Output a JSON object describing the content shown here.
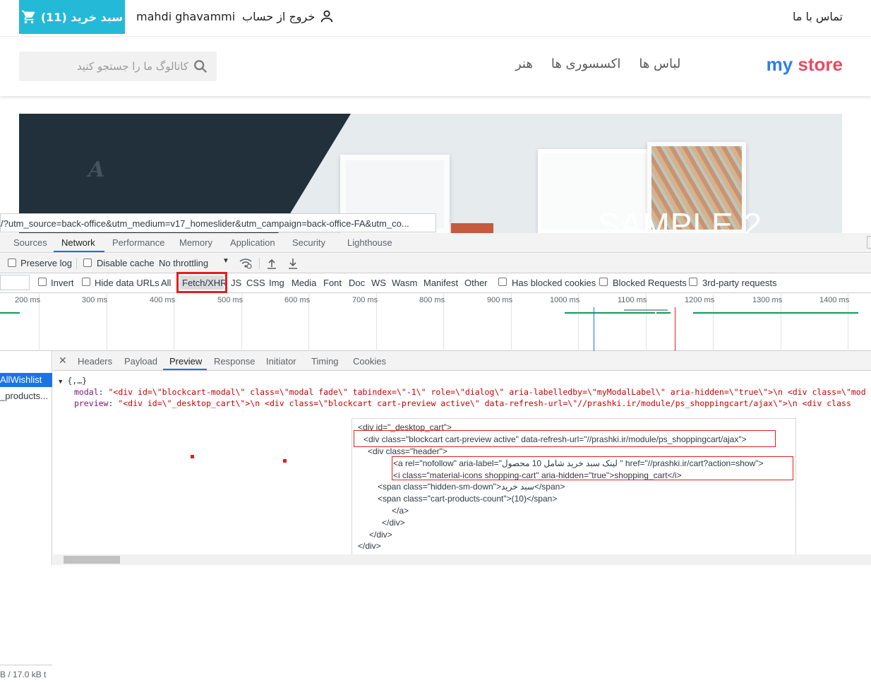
{
  "store": {
    "cart_label": "سبد خرید (11)",
    "username": "mahdi ghavammi",
    "logout_label": "خروج از حساب",
    "contact_label": "تماس با ما",
    "search_placeholder": "کاتالوگ ما را جستجو کنید",
    "nav": [
      "لباس ها",
      "اکسسوری ها",
      "هنر"
    ],
    "logo_my": "my",
    "logo_store": "store",
    "hero_text": "SAMPLE 2",
    "hero_mark": "A",
    "colors": {
      "cart_bg": "#24b9d7",
      "logo_my": "#2f7ee8",
      "logo_store": "#e94b63"
    }
  },
  "url_tooltip": "/?utm_source=back-office&utm_medium=v17_homeslider&utm_campaign=back-office-FA&utm_co...",
  "devtools": {
    "tabs": [
      "Sources",
      "Network",
      "Performance",
      "Memory",
      "Application",
      "Security",
      "Lighthouse"
    ],
    "active_tab": "Network",
    "toolbar": {
      "preserve_log": "Preserve log",
      "disable_cache": "Disable cache",
      "throttling": "No throttling"
    },
    "filters": {
      "invert": "Invert",
      "hide_data_urls": "Hide data URLs",
      "types": [
        "All",
        "Fetch/XHR",
        "JS",
        "CSS",
        "Img",
        "Media",
        "Font",
        "Doc",
        "WS",
        "Wasm",
        "Manifest",
        "Other"
      ],
      "selected_type": "Fetch/XHR",
      "has_blocked_cookies": "Has blocked cookies",
      "blocked_requests": "Blocked Requests",
      "third_party": "3rd-party requests"
    },
    "timeline_labels": [
      "200 ms",
      "300 ms",
      "400 ms",
      "500 ms",
      "600 ms",
      "700 ms",
      "800 ms",
      "900 ms",
      "1000 ms",
      "1100 ms",
      "1200 ms",
      "1300 ms",
      "1400 ms"
    ],
    "requests": [
      "AllWishlist",
      "_products..."
    ],
    "status_text": "B / 17.0 kB t",
    "detail_tabs": [
      "Headers",
      "Payload",
      "Preview",
      "Response",
      "Initiator",
      "Timing",
      "Cookies"
    ],
    "active_detail_tab": "Preview",
    "preview": {
      "root": "{,…}",
      "modal_key": "modal",
      "modal_value": "\"<div id=\\\"blockcart-modal\\\" class=\\\"modal fade\\\" tabindex=\\\"-1\\\" role=\\\"dialog\\\" aria-labelledby=\\\"myModalLabel\\\" aria-hidden=\\\"true\\\">\\n  <div class=\\\"mod",
      "preview_key": "preview",
      "preview_value": "\"<div id=\\\"_desktop_cart\\\">\\n  <div class=\\\"blockcart cart-preview active\\\" data-refresh-url=\\\"//prashki.ir/module/ps_shoppingcart/ajax\\\">\\n    <div class"
    },
    "code_lines": [
      "<div id=\"_desktop_cart\">",
      "<div class=\"blockcart cart-preview active\" data-refresh-url=\"//prashki.ir/module/ps_shoppingcart/ajax\">",
      "<div class=\"header\">",
      "<a rel=\"nofollow\" aria-label=\"لینک سبد خرید شامل 10 محصول \" href=\"//prashki.ir/cart?action=show\">",
      "<i class=\"material-icons shopping-cart\" aria-hidden=\"true\">shopping_cart</i>",
      "<span class=\"hidden-sm-down\">سبد خرید</span>",
      "<span class=\"cart-products-count\">(10)</span>",
      "</a>",
      "</div>",
      "</div>",
      "</div>"
    ]
  }
}
